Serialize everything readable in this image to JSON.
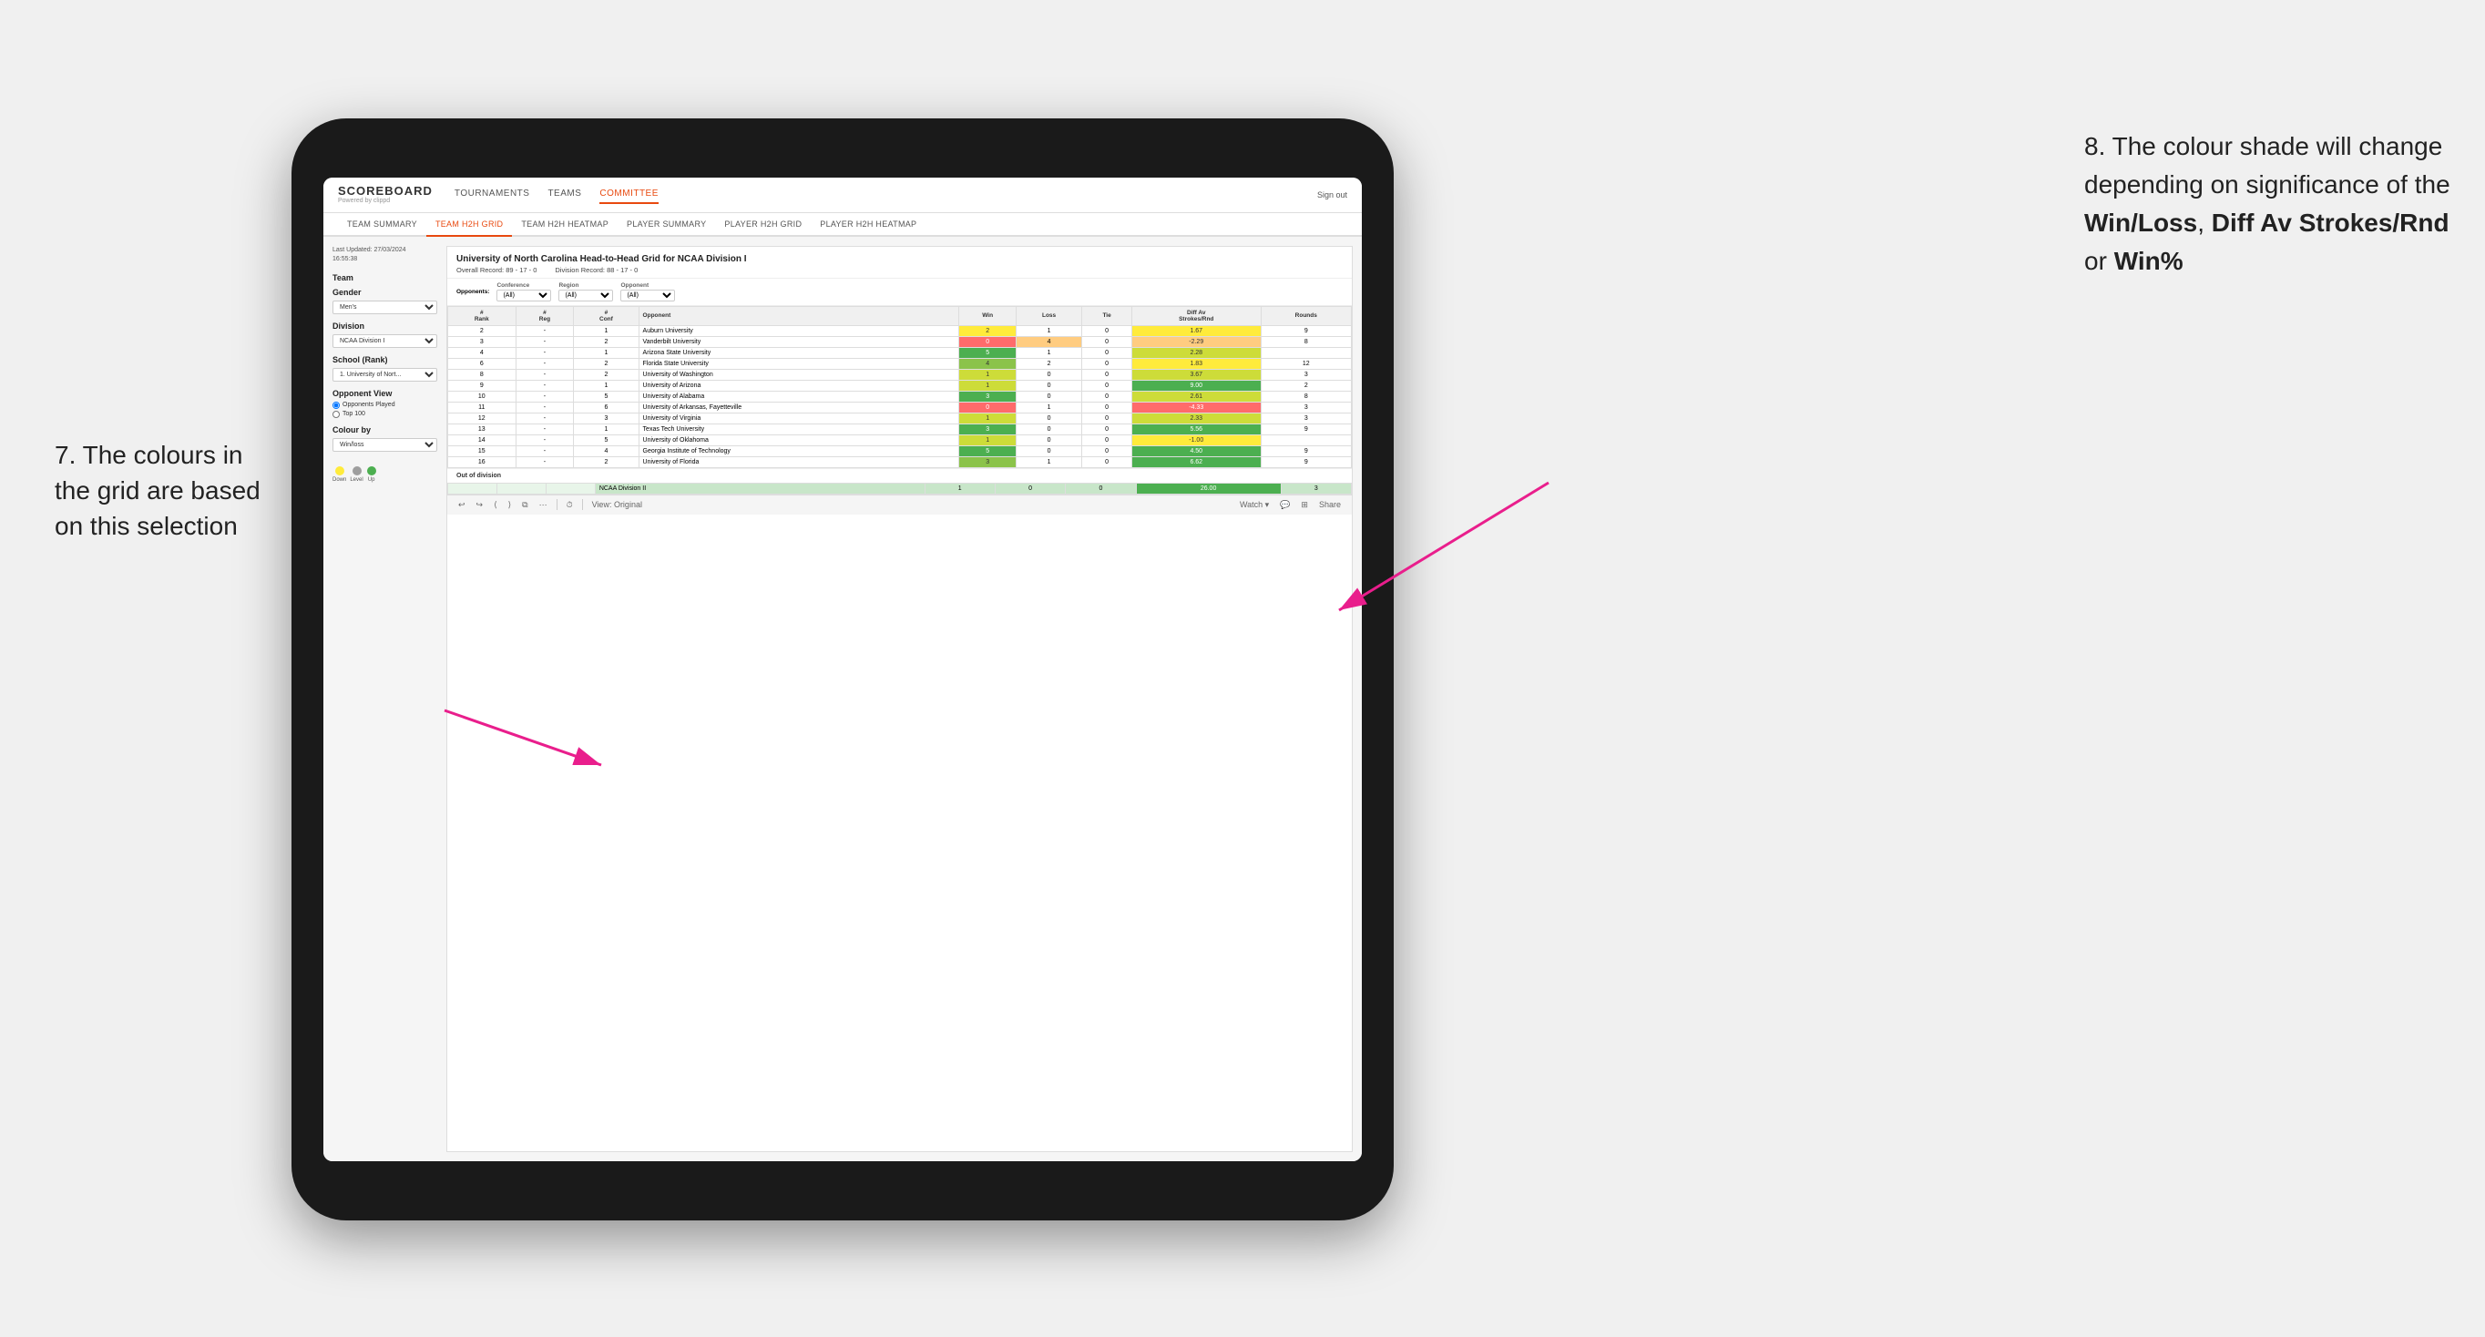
{
  "annotations": {
    "left": {
      "line1": "7. The colours in",
      "line2": "the grid are based",
      "line3": "on this selection"
    },
    "right": {
      "intro": "8. The colour shade will change depending on significance of the ",
      "bold1": "Win/Loss",
      "sep1": ", ",
      "bold2": "Diff Av Strokes/Rnd",
      "sep2": " or ",
      "bold3": "Win%"
    }
  },
  "nav": {
    "logo": "SCOREBOARD",
    "logo_sub": "Powered by clippd",
    "items": [
      "TOURNAMENTS",
      "TEAMS",
      "COMMITTEE"
    ],
    "active_item": "COMMITTEE",
    "sign_out": "Sign out"
  },
  "sub_nav": {
    "items": [
      "TEAM SUMMARY",
      "TEAM H2H GRID",
      "TEAM H2H HEATMAP",
      "PLAYER SUMMARY",
      "PLAYER H2H GRID",
      "PLAYER H2H HEATMAP"
    ],
    "active": "TEAM H2H GRID"
  },
  "left_panel": {
    "last_updated_label": "Last Updated: 27/03/2024",
    "last_updated_time": "16:55:38",
    "team_label": "Team",
    "gender_label": "Gender",
    "gender_value": "Men's",
    "division_label": "Division",
    "division_value": "NCAA Division I",
    "school_label": "School (Rank)",
    "school_value": "1. University of Nort...",
    "opponent_view_label": "Opponent View",
    "radio1": "Opponents Played",
    "radio2": "Top 100",
    "colour_by_label": "Colour by",
    "colour_by_value": "Win/loss",
    "legend": {
      "down": "Down",
      "level": "Level",
      "up": "Up"
    }
  },
  "grid": {
    "title": "University of North Carolina Head-to-Head Grid for NCAA Division I",
    "overall_record_label": "Overall Record:",
    "overall_record": "89 - 17 - 0",
    "division_record_label": "Division Record:",
    "division_record": "88 - 17 - 0",
    "filters": {
      "opponents_label": "Opponents:",
      "opponents_value": "(All)",
      "conference_label": "Conference",
      "conference_value": "(All)",
      "region_label": "Region",
      "region_value": "(All)",
      "opponent_label": "Opponent",
      "opponent_value": "(All)"
    },
    "columns": [
      "#\nRank",
      "#\nReg",
      "#\nConf",
      "Opponent",
      "Win",
      "Loss",
      "Tie",
      "Diff Av\nStrokes/Rnd",
      "Rounds"
    ],
    "rows": [
      {
        "rank": "2",
        "reg": "-",
        "conf": "1",
        "opponent": "Auburn University",
        "win": "2",
        "loss": "1",
        "tie": "0",
        "diff": "1.67",
        "rounds": "9",
        "win_color": "yellow",
        "loss_color": "white",
        "diff_color": "yellow"
      },
      {
        "rank": "3",
        "reg": "-",
        "conf": "2",
        "opponent": "Vanderbilt University",
        "win": "0",
        "loss": "4",
        "tie": "0",
        "diff": "-2.29",
        "rounds": "8",
        "win_color": "red",
        "loss_color": "orange",
        "diff_color": "orange"
      },
      {
        "rank": "4",
        "reg": "-",
        "conf": "1",
        "opponent": "Arizona State University",
        "win": "5",
        "loss": "1",
        "tie": "0",
        "diff": "2.28",
        "rounds": "",
        "win_color": "green_dark",
        "loss_color": "white",
        "diff_color": "green_light"
      },
      {
        "rank": "6",
        "reg": "-",
        "conf": "2",
        "opponent": "Florida State University",
        "win": "4",
        "loss": "2",
        "tie": "0",
        "diff": "1.83",
        "rounds": "12",
        "win_color": "green_med",
        "loss_color": "white",
        "diff_color": "yellow"
      },
      {
        "rank": "8",
        "reg": "-",
        "conf": "2",
        "opponent": "University of Washington",
        "win": "1",
        "loss": "0",
        "tie": "0",
        "diff": "3.67",
        "rounds": "3",
        "win_color": "green_light",
        "loss_color": "white",
        "diff_color": "green_light"
      },
      {
        "rank": "9",
        "reg": "-",
        "conf": "1",
        "opponent": "University of Arizona",
        "win": "1",
        "loss": "0",
        "tie": "0",
        "diff": "9.00",
        "rounds": "2",
        "win_color": "green_light",
        "loss_color": "white",
        "diff_color": "green_dark"
      },
      {
        "rank": "10",
        "reg": "-",
        "conf": "5",
        "opponent": "University of Alabama",
        "win": "3",
        "loss": "0",
        "tie": "0",
        "diff": "2.61",
        "rounds": "8",
        "win_color": "green_dark",
        "loss_color": "white",
        "diff_color": "green_light"
      },
      {
        "rank": "11",
        "reg": "-",
        "conf": "6",
        "opponent": "University of Arkansas, Fayetteville",
        "win": "0",
        "loss": "1",
        "tie": "0",
        "diff": "-4.33",
        "rounds": "3",
        "win_color": "red",
        "loss_color": "white",
        "diff_color": "red"
      },
      {
        "rank": "12",
        "reg": "-",
        "conf": "3",
        "opponent": "University of Virginia",
        "win": "1",
        "loss": "0",
        "tie": "0",
        "diff": "2.33",
        "rounds": "3",
        "win_color": "green_light",
        "loss_color": "white",
        "diff_color": "green_light"
      },
      {
        "rank": "13",
        "reg": "-",
        "conf": "1",
        "opponent": "Texas Tech University",
        "win": "3",
        "loss": "0",
        "tie": "0",
        "diff": "5.56",
        "rounds": "9",
        "win_color": "green_dark",
        "loss_color": "white",
        "diff_color": "green_dark"
      },
      {
        "rank": "14",
        "reg": "-",
        "conf": "5",
        "opponent": "University of Oklahoma",
        "win": "1",
        "loss": "0",
        "tie": "0",
        "diff": "-1.00",
        "rounds": "",
        "win_color": "green_light",
        "loss_color": "white",
        "diff_color": "yellow"
      },
      {
        "rank": "15",
        "reg": "-",
        "conf": "4",
        "opponent": "Georgia Institute of Technology",
        "win": "5",
        "loss": "0",
        "tie": "0",
        "diff": "4.50",
        "rounds": "9",
        "win_color": "green_dark",
        "loss_color": "white",
        "diff_color": "green_dark"
      },
      {
        "rank": "16",
        "reg": "-",
        "conf": "2",
        "opponent": "University of Florida",
        "win": "3",
        "loss": "1",
        "tie": "0",
        "diff": "6.62",
        "rounds": "9",
        "win_color": "green_med",
        "loss_color": "white",
        "diff_color": "green_dark"
      }
    ],
    "out_of_division_label": "Out of division",
    "out_of_division_row": {
      "division": "NCAA Division II",
      "win": "1",
      "loss": "0",
      "tie": "0",
      "diff": "26.00",
      "rounds": "3"
    }
  },
  "toolbar": {
    "view_label": "View: Original",
    "watch_label": "Watch ▾",
    "share_label": "Share"
  },
  "colors": {
    "green_dark": "#4caf50",
    "green_med": "#8bc34a",
    "green_light": "#cddc39",
    "yellow": "#ffeb3b",
    "orange": "#ffcc80",
    "red": "#ff6b6b",
    "pink_arrow": "#e91e8c",
    "accent": "#e8490f"
  }
}
